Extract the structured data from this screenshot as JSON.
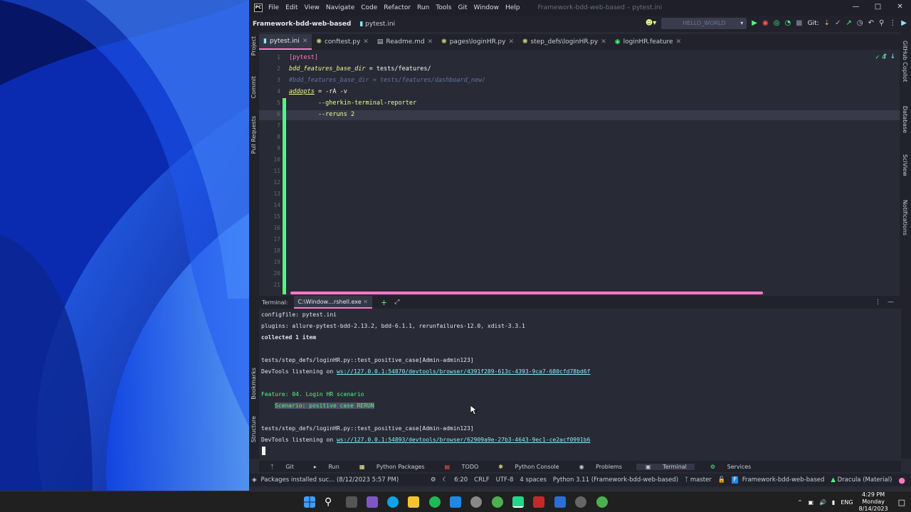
{
  "window": {
    "title": "Framework-bdd-web-based – pytest.ini",
    "menu": [
      "File",
      "Edit",
      "View",
      "Navigate",
      "Code",
      "Refactor",
      "Run",
      "Tools",
      "Git",
      "Window",
      "Help"
    ],
    "controls": [
      "—",
      "□",
      "✕"
    ]
  },
  "navbar": {
    "project": "Framework-bdd-web-based",
    "file": "pytest.ini",
    "run_config": "HELLO_WORLD",
    "git_label": "Git:"
  },
  "tabs": [
    {
      "label": "pytest.ini",
      "active": true
    },
    {
      "label": "conftest.py",
      "active": false
    },
    {
      "label": "Readme.md",
      "active": false
    },
    {
      "label": "pages\\loginHR.py",
      "active": false
    },
    {
      "label": "step_defs\\loginHR.py",
      "active": false
    },
    {
      "label": "loginHR.feature",
      "active": false
    }
  ],
  "side_left": {
    "project": "Project",
    "commit": "Commit",
    "pull_requests": "Pull Requests",
    "bookmarks": "Bookmarks",
    "structure": "Structure"
  },
  "side_right": {
    "copilot": "GitHub Copilot",
    "database": "Database",
    "sciview": "SciView",
    "notifications": "Notifications"
  },
  "editor": {
    "line_numbers": [
      "1",
      "2",
      "3",
      "4",
      "5",
      "6",
      "7",
      "8",
      "9",
      "10",
      "11",
      "12",
      "13",
      "14",
      "15",
      "16",
      "17",
      "18",
      "19",
      "20",
      "21"
    ],
    "lines": {
      "l1": "[pytest]",
      "l2_key": "bdd_features_base_dir",
      "l2_val": " = tests/features/",
      "l3": "#bdd_features_base_dir = tests/features/dashboard_new/",
      "l4_key": "addopts",
      "l4_val": " = -rA -v",
      "l5": "        --gherkin-terminal-reporter",
      "l6": "        --reruns 2"
    },
    "inspection": "✓ 4"
  },
  "terminal": {
    "label": "Terminal:",
    "tab": "C:\\Window…rshell.exe",
    "lines": {
      "t1": "configfile: pytest.ini",
      "t2": "plugins: allure-pytest-bdd-2.13.2, bdd-6.1.1, rerunfailures-12.0, xdist-3.3.1",
      "t3": "collected 1 item",
      "t4": "tests/step_defs/loginHR.py::test_positive_case[Admin-admin123]",
      "t5_pre": "DevTools listening on ",
      "t5_link": "ws://127.0.0.1:54870/devtools/browser/4391f289-613c-4393-9ca7-680cfd78bd6f",
      "t6": "Feature: 04. Login HR scenario",
      "t7": "Scenario: positive case RERUN",
      "t8": "tests/step_defs/loginHR.py::test_positive_case[Admin-admin123]",
      "t9_pre": "DevTools listening on ",
      "t9_link": "ws://127.0.0.1:54893/devtools/browser/62909a9e-27b3-4643-9ec1-ce2acf0991b6"
    }
  },
  "toolwindows": [
    "Git",
    "Run",
    "Python Packages",
    "TODO",
    "Python Console",
    "Problems",
    "Terminal",
    "Services"
  ],
  "status": {
    "message": "Packages installed suc... (8/12/2023 5:57 PM)",
    "position": "6:20",
    "line_sep": "CRLF",
    "encoding": "UTF-8",
    "indent": "4 spaces",
    "interpreter": "Python 3.11 (Framework-bdd-web-based)",
    "branch": "master",
    "project": "Framework-bdd-web-based",
    "theme": "Dracula (Material)"
  },
  "taskbar": {
    "lang": "ENG",
    "time": "4:29 PM",
    "day": "Monday",
    "date": "8/14/2023"
  },
  "colors": {
    "accent": "#ff79c6",
    "change_bar": "#50fa7b",
    "background": "#282a36"
  }
}
